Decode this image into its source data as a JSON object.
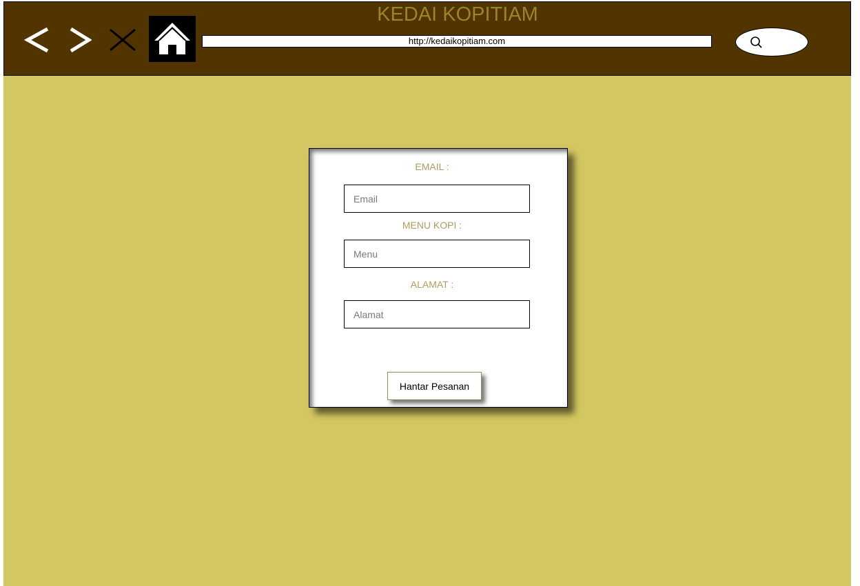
{
  "header": {
    "site_title": "KEDAI KOPITIAM",
    "address_url": "http://kedaikopitiam.com",
    "icons": {
      "back": "chevron-left-icon",
      "forward": "chevron-right-icon",
      "close": "close-icon",
      "home": "home-icon",
      "search": "search-icon"
    }
  },
  "form": {
    "email_label": "EMAIL :",
    "email_placeholder": "Email",
    "menu_label": "MENU KOPI :",
    "menu_placeholder": "Menu",
    "alamat_label": "ALAMAT :",
    "alamat_placeholder": "Alamat",
    "submit_label": "Hantar Pesanan"
  },
  "colors": {
    "header_background": "#513400",
    "page_background": "#d3c762",
    "title_color": "#9a8526",
    "label_color": "#b39a5e"
  }
}
